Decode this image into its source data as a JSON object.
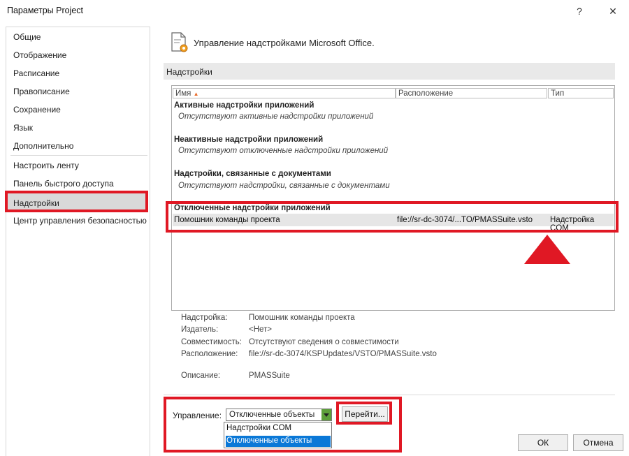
{
  "window": {
    "title": "Параметры Project",
    "help_glyph": "?",
    "close_glyph": "✕"
  },
  "sidebar": {
    "items": [
      {
        "label": "Общие"
      },
      {
        "label": "Отображение"
      },
      {
        "label": "Расписание"
      },
      {
        "label": "Правописание"
      },
      {
        "label": "Сохранение"
      },
      {
        "label": "Язык"
      },
      {
        "label": "Дополнительно"
      },
      {
        "label": "Настроить ленту"
      },
      {
        "label": "Панель быстрого доступа"
      },
      {
        "label": "Надстройки"
      },
      {
        "label": "Центр управления безопасностью"
      }
    ],
    "selected": "Надстройки"
  },
  "header": {
    "text": "Управление надстройками Microsoft Office.",
    "icon": "addins-icon"
  },
  "section": {
    "title": "Надстройки"
  },
  "table": {
    "columns": [
      "Имя",
      "Расположение",
      "Тип"
    ],
    "sort_glyph": "▲",
    "groups": [
      {
        "title": "Активные надстройки приложений",
        "empty": "Отсутствуют активные надстройки приложений"
      },
      {
        "title": "Неактивные надстройки приложений",
        "empty": "Отсутствуют отключенные надстройки приложений"
      },
      {
        "title": "Надстройки, связанные с документами",
        "empty": "Отсутствуют надстройки, связанные с документами"
      },
      {
        "title": "Отключенные надстройки приложений"
      }
    ],
    "selected_row": {
      "name": "Помошник команды проекта",
      "location": "file://sr-dc-3074/...TO/PMASSuite.vsto",
      "type": "Надстройка COM"
    }
  },
  "details": {
    "addin_label": "Надстройка:",
    "addin_value": "Помошник команды проекта",
    "publisher_label": "Издатель:",
    "publisher_value": "<Нет>",
    "compat_label": "Совместимость:",
    "compat_value": "Отсутствуют сведения о совместимости",
    "location_label": "Расположение:",
    "location_value": "file://sr-dc-3074/KSPUpdates/VSTO/PMASSuite.vsto",
    "description_label": "Описание:",
    "description_value": "PMASSuite"
  },
  "manage": {
    "label": "Управление:",
    "selected": "Отключенные объекты",
    "options": [
      "Надстройки COM",
      "Отключенные объекты"
    ],
    "go_button": "Перейти..."
  },
  "footer": {
    "ok": "ОК",
    "cancel": "Отмена"
  },
  "colors": {
    "highlight_red": "#e01824",
    "selection_blue": "#0a78d7",
    "combo_arrow_green": "#5ea03a"
  }
}
